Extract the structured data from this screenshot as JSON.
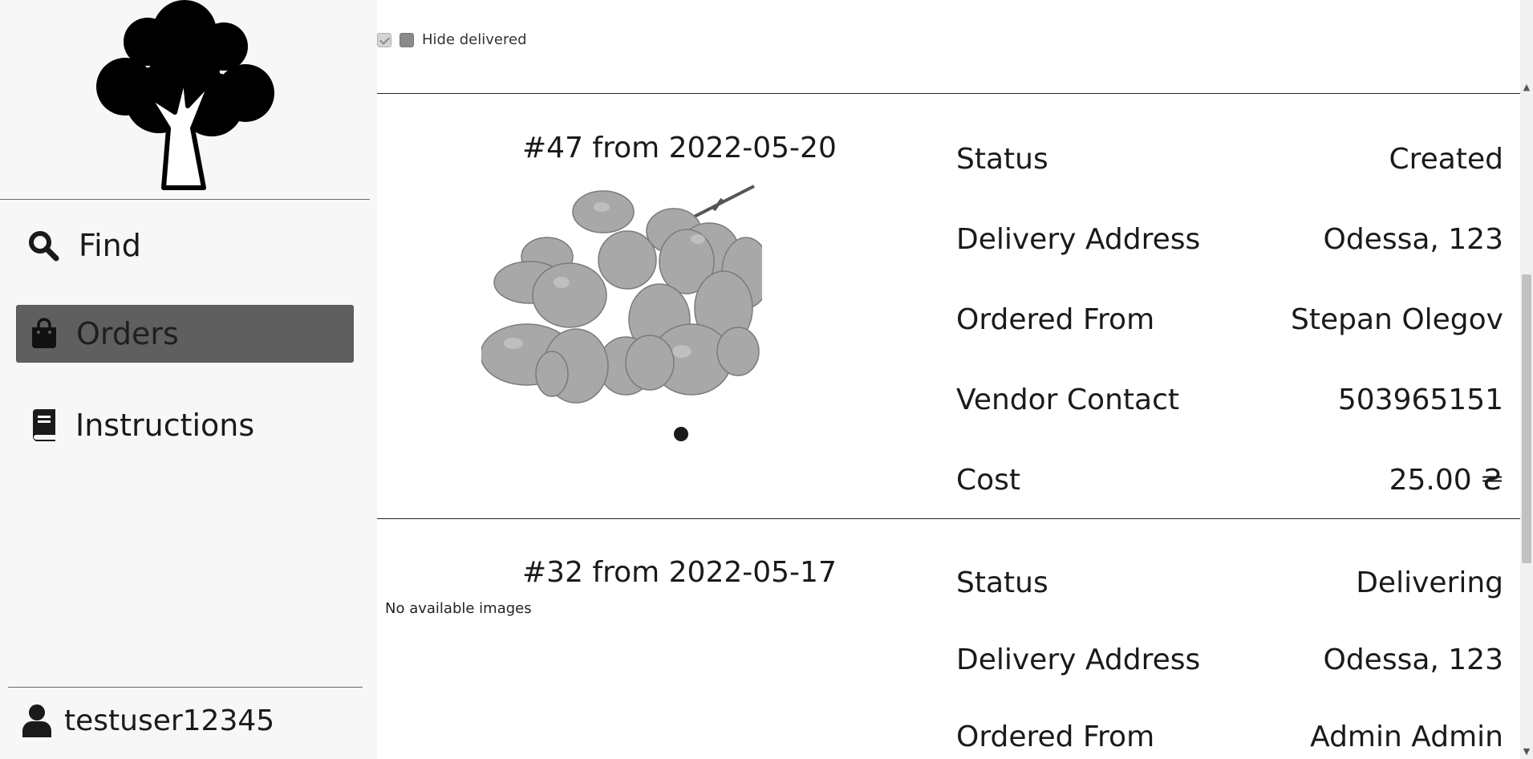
{
  "sidebar": {
    "logo_icon": "tree-icon",
    "nav": [
      {
        "label": "Find",
        "icon": "search-icon"
      },
      {
        "label": "Orders",
        "icon": "shopping-bag-icon",
        "active": true
      },
      {
        "label": "Instructions",
        "icon": "book-icon"
      }
    ],
    "user": {
      "name": "testuser12345",
      "icon": "user-icon"
    }
  },
  "filters": {
    "hide_delivered_label": "Hide delivered",
    "hide_delivered_checked": false
  },
  "orders": [
    {
      "title": "#47 from 2022-05-20",
      "image": "grapes",
      "fields": [
        {
          "label": "Status",
          "value": "Created"
        },
        {
          "label": "Delivery Address",
          "value": "Odessa, 123"
        },
        {
          "label": "Ordered From",
          "value": "Stepan Olegov"
        },
        {
          "label": "Vendor Contact",
          "value": "503965151"
        },
        {
          "label": "Cost",
          "value": "25.00 ₴"
        }
      ]
    },
    {
      "title": "#32 from 2022-05-17",
      "no_images_text": "No available images",
      "fields": [
        {
          "label": "Status",
          "value": "Delivering"
        },
        {
          "label": "Delivery Address",
          "value": "Odessa, 123"
        },
        {
          "label": "Ordered From",
          "value": "Admin Admin"
        }
      ]
    }
  ]
}
